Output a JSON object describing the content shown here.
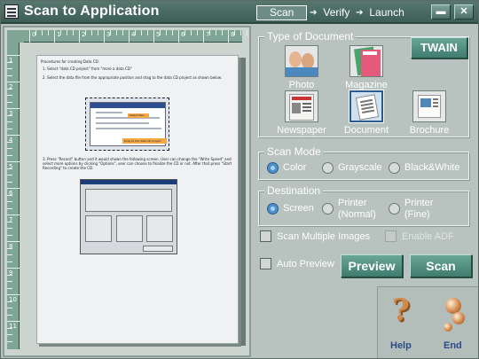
{
  "window": {
    "title": "Scan to Application",
    "steps": [
      "Scan",
      "Verify",
      "Launch"
    ],
    "active_step": "Scan",
    "step_arrow": "➔",
    "minimize_glyph": "▬",
    "close_glyph": "✕"
  },
  "preview": {
    "ruler_top_labels": [
      "0",
      "1",
      "2",
      "3",
      "4",
      "5",
      "6",
      "7",
      "8"
    ],
    "ruler_left_labels": [
      "1",
      "2",
      "3",
      "4",
      "5",
      "6",
      "7",
      "8",
      "9",
      "10",
      "11"
    ],
    "document_lines": [
      "Procedures for creating Data CD:",
      "1. Select \"data CD project\" from \"more a data CD\"",
      "2. Select the data file from the appropriate position and drag to the data CD project as shown below.",
      "3. Press \"Record\" button and it would shown the following screen. User can change the \"Write Speed\" and",
      "select more options by clicking \"Options\", user can choose to finalize the CD or not. After that press \"Start",
      "Recording\" to create the CD."
    ],
    "shot1_label_1": "Select files",
    "shot1_label_2": "Drag to the data CD project"
  },
  "document_type": {
    "title": "Type of Document",
    "options": [
      {
        "label": "Photo",
        "icon": "photo-icon"
      },
      {
        "label": "Magazine",
        "icon": "magazine-icon"
      },
      {
        "label": "Newspaper",
        "icon": "newspaper-icon"
      },
      {
        "label": "Document",
        "icon": "document-icon"
      },
      {
        "label": "Brochure",
        "icon": "brochure-icon"
      }
    ],
    "selected": "Document"
  },
  "twain_label": "TWAIN",
  "scan_mode": {
    "title": "Scan Mode",
    "options": [
      "Color",
      "Grayscale",
      "Black&White"
    ],
    "selected": "Color"
  },
  "destination": {
    "title": "Destination",
    "options": [
      {
        "line1": "Screen",
        "line2": ""
      },
      {
        "line1": "Printer",
        "line2": "(Normal)"
      },
      {
        "line1": "Printer",
        "line2": "(Fine)"
      }
    ],
    "selected": "Screen"
  },
  "options": {
    "scan_multiple": "Scan Multiple Images",
    "enable_adf": "Enable ADF",
    "auto_preview": "Auto Preview"
  },
  "actions": {
    "preview": "Preview",
    "scan": "Scan",
    "help": "Help",
    "end": "End",
    "help_glyph": "?"
  },
  "colors": {
    "accent": "#4f8d7e",
    "titlebar": "#4a6b62",
    "panel": "#b8c2be",
    "selected_radio": "#4d90cc"
  }
}
